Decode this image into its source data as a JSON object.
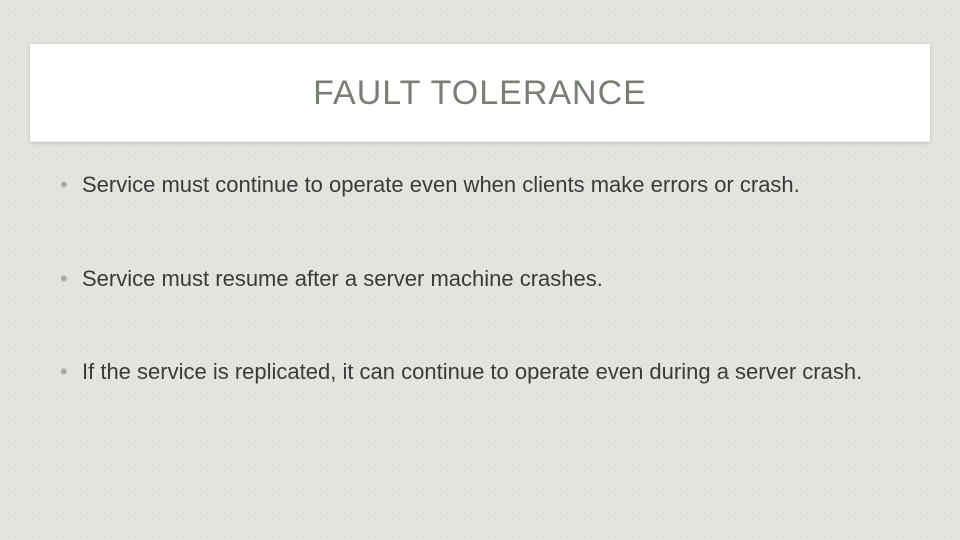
{
  "slide": {
    "title": "FAULT TOLERANCE",
    "bullets": [
      "Service must continue to operate even when clients make errors or crash.",
      "Service must resume after a server machine crashes.",
      "If the service is replicated, it can continue to operate even during a server crash."
    ]
  }
}
